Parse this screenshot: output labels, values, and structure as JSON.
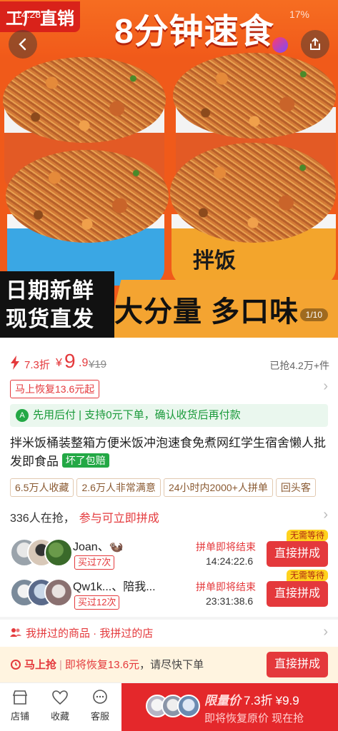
{
  "status_bar": {
    "time": "14:28",
    "battery": "17%"
  },
  "hero": {
    "factory_badge": "工厂直销",
    "headline": "8分钟速食",
    "cup_label": "拌饭",
    "promo_left_line1": "日期新鲜",
    "promo_left_line2": "现货直发",
    "promo_right": "大分量 多口味",
    "counter": "1/10",
    "icons": [
      "back-arrow-icon",
      "share-icon"
    ]
  },
  "price": {
    "discount": "7.3折",
    "currency": "¥",
    "value": "9",
    "value_suffix": ".9",
    "original": "¥19",
    "sold": "已抢4.2万+件",
    "coupon": "马上恢复13.6元起"
  },
  "pay_later": {
    "icon": "A",
    "text": "先用后付 | 支持0元下单，确认收货后再付款"
  },
  "product": {
    "title": "拌米饭桶装整箱方便米饭冲泡速食免煮网红学生宿舍懒人批发即食品",
    "tag": "坏了包赔"
  },
  "chips": [
    "6.5万人收藏",
    "2.6万人非常满意",
    "24小时内2000+人拼单",
    "回头客"
  ],
  "group": {
    "count_text": "336人在抢，",
    "join_text": "参与可立即拼成",
    "items": [
      {
        "name": "Joan、🦦",
        "bought": "买过7次",
        "ending": "拼单即将结束",
        "time": "14:24:22.6",
        "button": "直接拼成",
        "badge": "无需等待"
      },
      {
        "name": "Qw1k...、陪我...",
        "bought": "买过12次",
        "ending": "拼单即将结束",
        "time": "23:31:38.6",
        "button": "直接拼成",
        "badge": "无需等待"
      }
    ]
  },
  "my_groups": "我拼过的商品 · 我拼过的店",
  "grab_bar": {
    "label": "马上抢",
    "highlight": "即将恢复13.6元",
    "rest": "，请尽快下单",
    "button": "直接拼成"
  },
  "bottom_nav": {
    "store": "店铺",
    "favorite": "收藏",
    "service": "客服",
    "buy_label": "限量价",
    "buy_discount": "7.3折",
    "buy_price": "¥9.9",
    "buy_sub": "即将恢复原价 现在抢"
  },
  "colors": {
    "accent_red": "#e4393c",
    "hero_orange": "#f05a1a",
    "pay_green": "#23a845"
  }
}
